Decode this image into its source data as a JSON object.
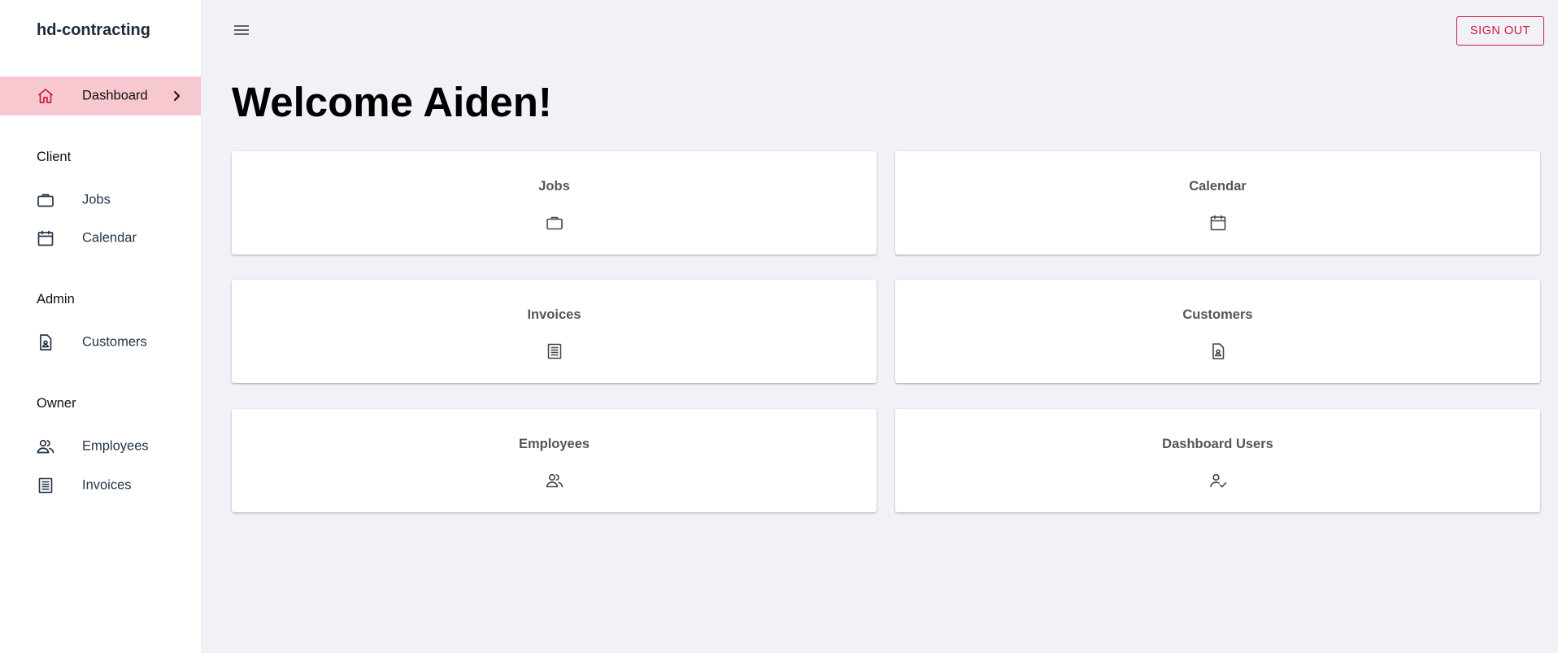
{
  "app": {
    "brand": "hd-contracting"
  },
  "sidebar": {
    "active": {
      "label": "Dashboard",
      "icon": "home-icon"
    },
    "sections": [
      {
        "title": "Client",
        "items": [
          {
            "label": "Jobs",
            "icon": "briefcase-icon"
          },
          {
            "label": "Calendar",
            "icon": "calendar-icon"
          }
        ]
      },
      {
        "title": "Admin",
        "items": [
          {
            "label": "Customers",
            "icon": "contact-document-icon"
          }
        ]
      },
      {
        "title": "Owner",
        "items": [
          {
            "label": "Employees",
            "icon": "people-icon"
          },
          {
            "label": "Invoices",
            "icon": "list-document-icon"
          }
        ]
      }
    ]
  },
  "header": {
    "menu_icon": "hamburger-menu-icon",
    "signout_label": "SIGN OUT"
  },
  "main": {
    "welcome": "Welcome Aiden!",
    "cards": [
      {
        "title": "Jobs",
        "icon": "briefcase-icon"
      },
      {
        "title": "Calendar",
        "icon": "calendar-icon"
      },
      {
        "title": "Invoices",
        "icon": "list-document-icon"
      },
      {
        "title": "Customers",
        "icon": "contact-document-icon"
      },
      {
        "title": "Employees",
        "icon": "people-icon"
      },
      {
        "title": "Dashboard Users",
        "icon": "user-check-icon"
      }
    ]
  },
  "colors": {
    "accent": "#c81e3a",
    "active_bg": "#f8c8d0",
    "page_bg": "#f2f1f7",
    "sidebar_bg": "#ffffff"
  }
}
